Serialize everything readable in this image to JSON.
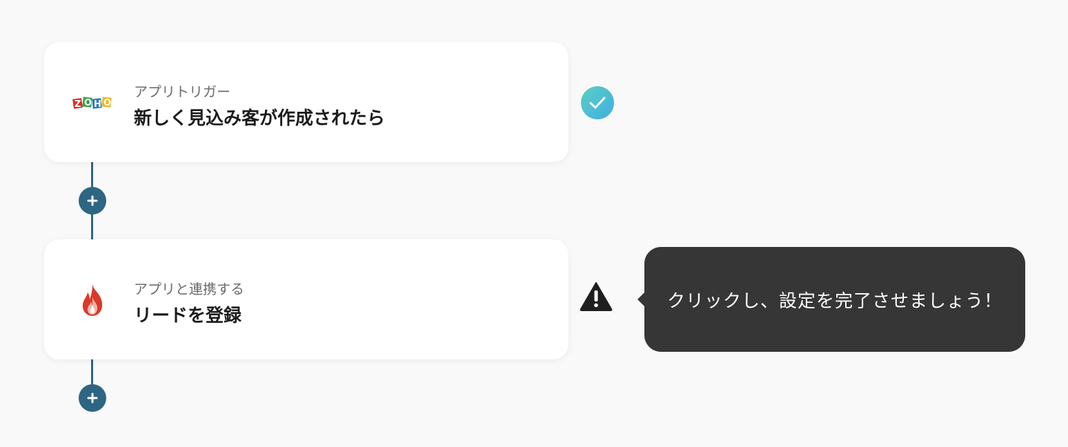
{
  "flow": {
    "steps": [
      {
        "caption": "アプリトリガー",
        "title": "新しく見込み客が作成されたら",
        "app_logo": "zoho-logo",
        "logo_text": "ZOHO",
        "status": "completed",
        "status_icon": "check-circle-icon",
        "status_color": "#4fc3c9"
      },
      {
        "caption": "アプリと連携する",
        "title": "リードを登録",
        "app_logo": "flame-logo",
        "status": "incomplete",
        "status_icon": "warning-icon",
        "status_color": "#222222"
      }
    ],
    "add_step_icon": "plus-icon",
    "connector_color": "#2e6583"
  },
  "tooltip": {
    "text": "クリックし、設定を完了させましょう！"
  }
}
